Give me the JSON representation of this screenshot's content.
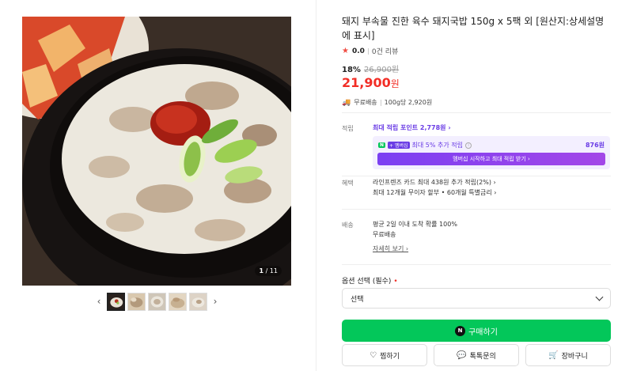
{
  "gallery": {
    "counter_current": "1",
    "counter_total": " / 11",
    "prev_arrow": "‹",
    "next_arrow": "›"
  },
  "product": {
    "title": "돼지 부속물 진한 육수 돼지국밥 150g x 5팩 외 [원산지:상세설명에 표시]",
    "rating_score": "0.0",
    "review_count": "0건 리뷰",
    "discount": "18%",
    "original_price": "26,900원",
    "price": "21,900",
    "price_unit": "원",
    "shipping": "무료배송",
    "unit_price": "100g당 2,920원"
  },
  "points": {
    "label": "적립",
    "max_point": "최대 적립 포인트 2,778원 ›",
    "n_badge": "N",
    "member_badge": "+ 멤버십",
    "member_text": "최대 5% 추가 적립",
    "member_amount": "876원",
    "member_button": "멤버십 시작하고 최대 적립 받기 ›"
  },
  "benefits": {
    "label": "혜택",
    "line1": "라인프렌즈 카드 최대 438원 추가 적립(2%) ›",
    "line2": "최대 12개월 무이자 할부 • 60개월 특별금리 ›"
  },
  "delivery": {
    "label": "배송",
    "line1": "평균 2일 이내 도착 확률 100%",
    "line2": "무료배송",
    "more": "자세히 보기 ›"
  },
  "options": {
    "label": "옵션 선택 (필수)",
    "required_mark": "•",
    "selected": "선택"
  },
  "actions": {
    "buy_icon": "N",
    "buy": "구매하기",
    "wish": "찜하기",
    "talk": "톡톡문의",
    "cart": "장바구니"
  },
  "colors": {
    "price_red": "#f22e26",
    "buy_green": "#03c75a",
    "member_purple": "#6a3ce5"
  },
  "icons": {
    "star": "star-icon",
    "truck": "truck-icon",
    "heart": "heart-icon",
    "chat": "chat-icon",
    "cart": "cart-icon"
  }
}
